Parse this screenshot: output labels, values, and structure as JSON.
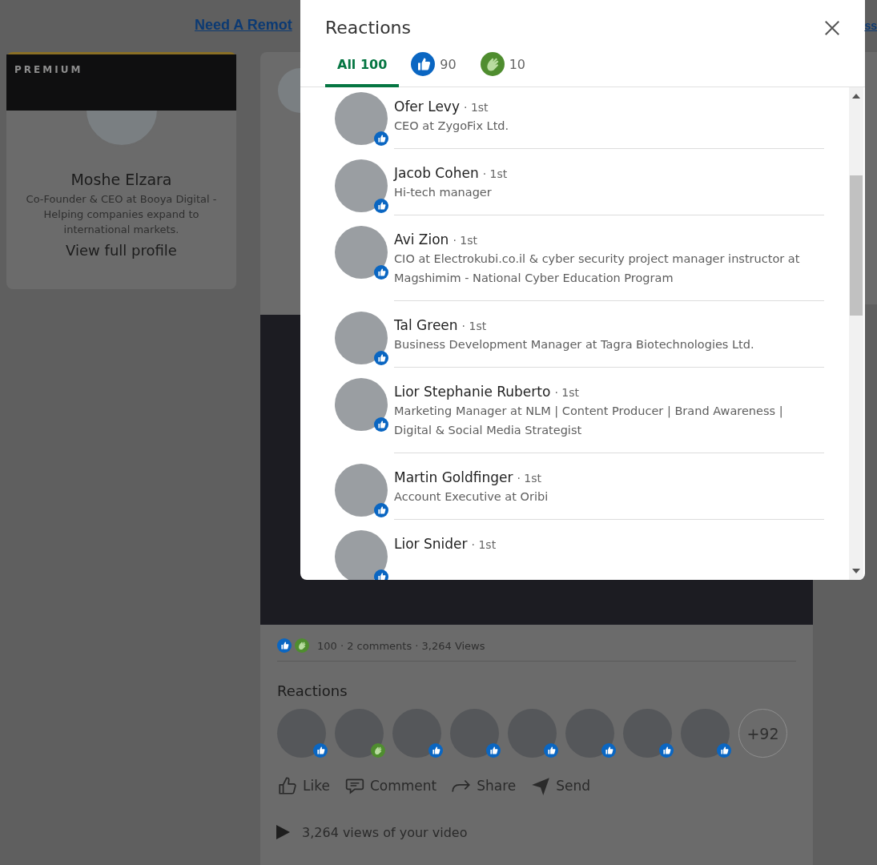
{
  "top_link": {
    "text": "Need A Remot",
    "text_right": "ss"
  },
  "profile_card": {
    "badge": "PREMIUM",
    "name": "Moshe Elzara",
    "headline": "Co-Founder & CEO at Booya Digital - Helping companies expand to international markets.",
    "link": "View full profile"
  },
  "post": {
    "summary": {
      "reaction_icons": [
        {
          "kind": "like"
        },
        {
          "kind": "celebrate"
        }
      ],
      "text": "100 · 2 comments · 3,264 Views"
    },
    "reactions_heading": "Reactions",
    "reactors": [
      {
        "kind": "like"
      },
      {
        "kind": "celebrate"
      },
      {
        "kind": "like"
      },
      {
        "kind": "like"
      },
      {
        "kind": "like"
      },
      {
        "kind": "like"
      },
      {
        "kind": "like"
      },
      {
        "kind": "like"
      }
    ],
    "more": "+92",
    "actions": [
      {
        "kind": "like",
        "label": "Like"
      },
      {
        "kind": "comment",
        "label": "Comment"
      },
      {
        "kind": "share",
        "label": "Share"
      },
      {
        "kind": "send",
        "label": "Send"
      }
    ],
    "video_views": "3,264 views of your video"
  },
  "modal": {
    "title": "Reactions",
    "tabs": [
      {
        "kind": "all",
        "label": "All 100",
        "selected": true
      },
      {
        "kind": "like",
        "label": "90",
        "selected": false
      },
      {
        "kind": "celebrate",
        "label": "10",
        "selected": false
      }
    ],
    "people": [
      {
        "name": "Ofer Levy",
        "degree": "· 1st",
        "headline": "CEO at ZygoFix Ltd.",
        "kind": "like"
      },
      {
        "name": "Jacob Cohen",
        "degree": "· 1st",
        "headline": "Hi-tech manager",
        "kind": "like"
      },
      {
        "name": "Avi Zion",
        "degree": "· 1st",
        "headline": "CIO at Electrokubi.co.il & cyber security project manager instructor at Magshimim - National Cyber Education Program",
        "kind": "like"
      },
      {
        "name": "Tal Green",
        "degree": "· 1st",
        "headline": "Business Development Manager at Tagra Biotechnologies Ltd.",
        "kind": "like"
      },
      {
        "name": "Lior Stephanie Ruberto",
        "degree": "· 1st",
        "headline": "Marketing Manager at NLM | Content Producer | Brand Awareness | Digital & Social Media Strategist",
        "kind": "like"
      },
      {
        "name": "Martin Goldfinger",
        "degree": "· 1st",
        "headline": "Account Executive at Oribi",
        "kind": "like"
      },
      {
        "name": "Lior Snider",
        "degree": "· 1st",
        "kind": "like"
      }
    ]
  }
}
